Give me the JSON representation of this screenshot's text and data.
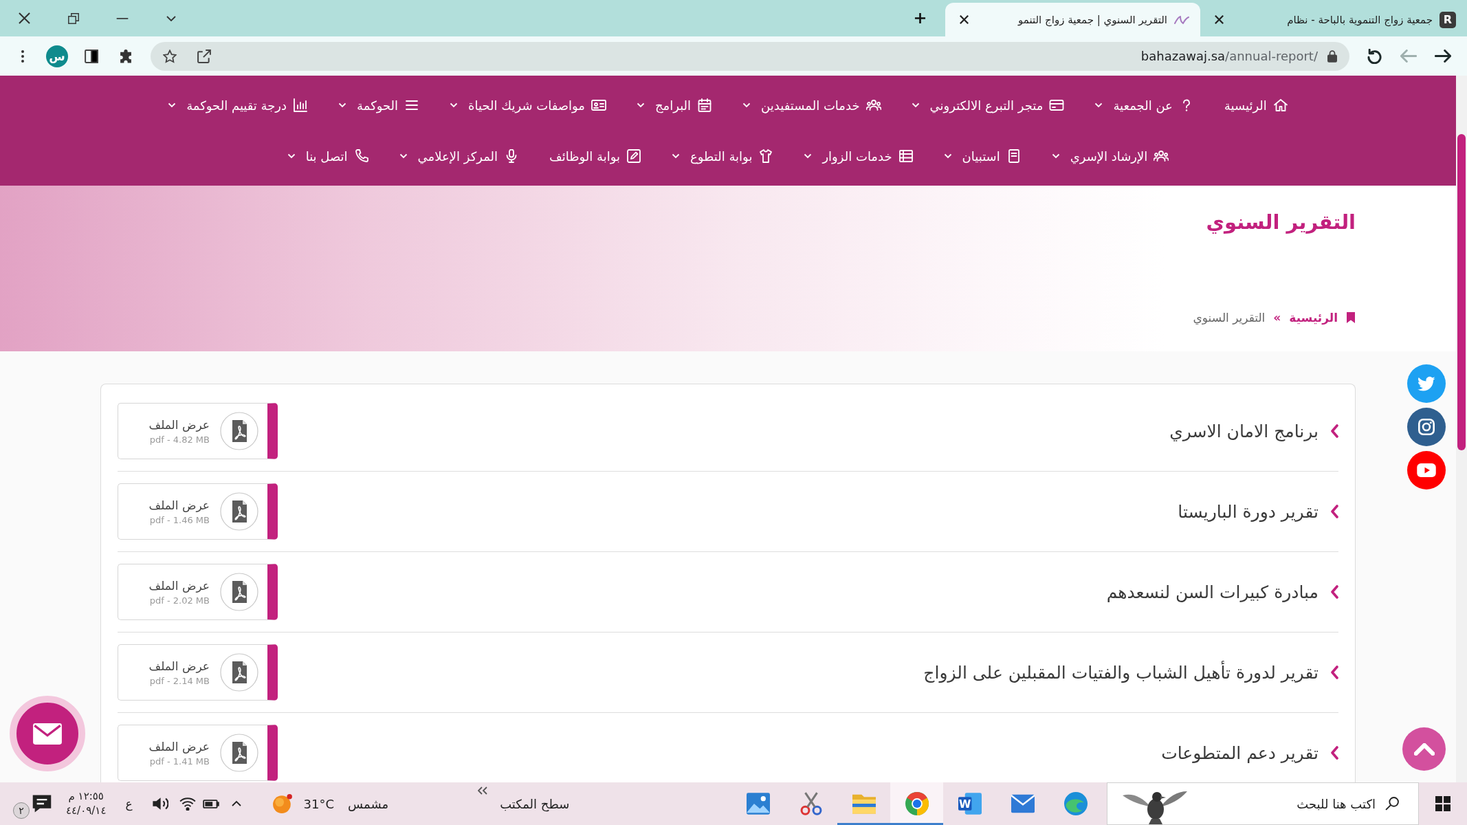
{
  "browser": {
    "tabs": [
      {
        "title": "جمعية زواج التنموية بالباحة - نظام",
        "favicon_text": "R",
        "selected": false
      },
      {
        "title": "التقرير السنوي | جمعية زواج التنمو",
        "selected": true
      }
    ],
    "nav_buttons": [
      {
        "kind": "back",
        "disabled": false
      },
      {
        "kind": "forward",
        "disabled": true
      }
    ],
    "url": {
      "host": "bahazawaj.sa",
      "path": "/annual-report/"
    },
    "profile_initial": "س"
  },
  "site": {
    "menu_rows": [
      [
        {
          "label": "الرئيسية",
          "dropdown": false
        },
        {
          "label": "عن الجمعية",
          "dropdown": true
        },
        {
          "label": "متجر التبرع الالكتروني",
          "dropdown": true
        },
        {
          "label": "خدمات المستفيدين",
          "dropdown": true
        },
        {
          "label": "البرامج",
          "dropdown": true
        },
        {
          "label": "مواصفات شريك الحياة",
          "dropdown": true
        },
        {
          "label": "الحوكمة",
          "dropdown": true
        },
        {
          "label": "درجة تقييم الحوكمة",
          "dropdown": true
        }
      ],
      [
        {
          "label": "الإرشاد الإسري",
          "dropdown": true
        },
        {
          "label": "استبيان",
          "dropdown": true
        },
        {
          "label": "خدمات الزوار",
          "dropdown": true
        },
        {
          "label": "بوابة التطوع",
          "dropdown": true
        },
        {
          "label": "بوابة الوظائف",
          "dropdown": false
        },
        {
          "label": "المركز الإعلامي",
          "dropdown": true
        },
        {
          "label": "اتصل بنا",
          "dropdown": true
        }
      ]
    ],
    "page_title": "التقرير السنوي",
    "breadcrumb": [
      {
        "label": "الرئيسية",
        "current": false
      },
      {
        "label": "التقرير السنوي",
        "current": true
      }
    ],
    "breadcrumb_separator": "»",
    "reports": [
      {
        "title": "برنامج الامان الاسري",
        "file_label": "عرض الملف",
        "file_info": "pdf - 4.82 MB"
      },
      {
        "title": "تقرير دورة الباريستا",
        "file_label": "عرض الملف",
        "file_info": "pdf - 1.46 MB"
      },
      {
        "title": "مبادرة كبيرات السن لنسعدهم",
        "file_label": "عرض الملف",
        "file_info": "pdf - 2.02 MB"
      },
      {
        "title": "تقرير لدورة تأهيل الشباب والفتيات المقبلين على الزواج",
        "file_label": "عرض الملف",
        "file_info": "pdf - 2.14 MB"
      },
      {
        "title": "تقرير دعم المتطوعات",
        "file_label": "عرض الملف",
        "file_info": "pdf - 1.41 MB"
      }
    ]
  },
  "taskbar": {
    "search": {
      "placeholder": "اكتب هنا للبحث"
    },
    "apps": [
      {
        "kind": "edge",
        "open": false,
        "selected": false
      },
      {
        "kind": "mail",
        "open": false,
        "selected": false
      },
      {
        "kind": "word",
        "label": "W",
        "open": false,
        "selected": false
      },
      {
        "kind": "chrome",
        "open": true,
        "selected": true
      },
      {
        "kind": "explorer",
        "open": true,
        "selected": false
      },
      {
        "kind": "snipping",
        "open": false,
        "selected": false
      },
      {
        "kind": "photos",
        "open": false,
        "selected": false
      }
    ],
    "desktop_label": "سطح المكتب",
    "weather": {
      "condition": "مشمس",
      "temperature": "31°C"
    },
    "language": "ع",
    "clock": {
      "time": "١٢:٥٥ م",
      "date": "٤٤/٠٩/١٤"
    },
    "notification_badge": "٢"
  }
}
